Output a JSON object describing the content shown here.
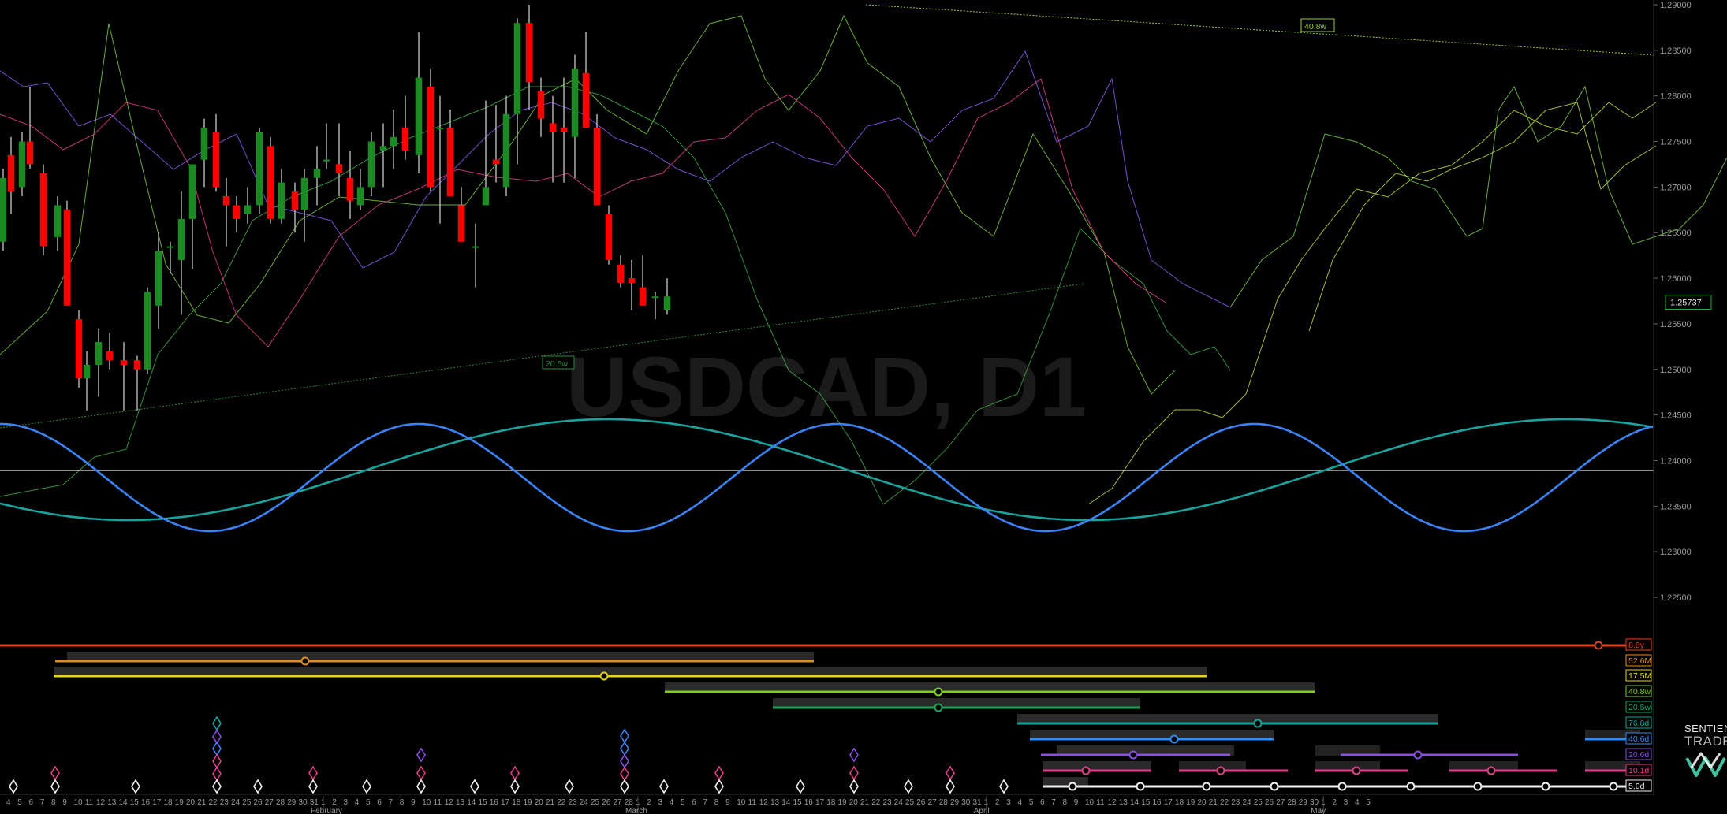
{
  "chart_data": {
    "type": "candlestick",
    "symbol": "USDCAD, D1",
    "yaxis": {
      "range": [
        1.2175,
        1.2905
      ],
      "ticks": [
        "1.29000",
        "1.28500",
        "1.28000",
        "1.27500",
        "1.27000",
        "1.26500",
        "1.26000",
        "1.25500",
        "1.25000",
        "1.24500",
        "1.24000",
        "1.23500",
        "1.23000",
        "1.22500"
      ]
    },
    "current_price": "1.25737",
    "candles": [
      {
        "o": 1.264,
        "h": 1.272,
        "l": 1.263,
        "c": 1.271
      },
      {
        "o": 1.2735,
        "h": 1.2755,
        "l": 1.267,
        "c": 1.2695
      },
      {
        "o": 1.27,
        "h": 1.276,
        "l": 1.269,
        "c": 1.275
      },
      {
        "o": 1.275,
        "h": 1.281,
        "l": 1.272,
        "c": 1.2725
      },
      {
        "o": 1.2715,
        "h": 1.2725,
        "l": 1.2625,
        "c": 1.2635
      },
      {
        "o": 1.2645,
        "h": 1.269,
        "l": 1.263,
        "c": 1.268
      },
      {
        "o": 1.2675,
        "h": 1.2685,
        "l": 1.257,
        "c": 1.257
      },
      {
        "o": 1.2555,
        "h": 1.2565,
        "l": 1.248,
        "c": 1.249
      },
      {
        "o": 1.249,
        "h": 1.252,
        "l": 1.2455,
        "c": 1.2505
      },
      {
        "o": 1.2505,
        "h": 1.2545,
        "l": 1.247,
        "c": 1.253
      },
      {
        "o": 1.252,
        "h": 1.254,
        "l": 1.25,
        "c": 1.251
      },
      {
        "o": 1.251,
        "h": 1.253,
        "l": 1.2455,
        "c": 1.2505
      },
      {
        "o": 1.251,
        "h": 1.2515,
        "l": 1.2455,
        "c": 1.25
      },
      {
        "o": 1.25,
        "h": 1.259,
        "l": 1.2495,
        "c": 1.2585
      },
      {
        "o": 1.257,
        "h": 1.265,
        "l": 1.2545,
        "c": 1.263
      },
      {
        "o": 1.2635,
        "h": 1.264,
        "l": 1.2605,
        "c": 1.2635
      },
      {
        "o": 1.262,
        "h": 1.2695,
        "l": 1.256,
        "c": 1.2665
      },
      {
        "o": 1.2665,
        "h": 1.2725,
        "l": 1.261,
        "c": 1.2725
      },
      {
        "o": 1.273,
        "h": 1.2775,
        "l": 1.27,
        "c": 1.2765
      },
      {
        "o": 1.276,
        "h": 1.278,
        "l": 1.2695,
        "c": 1.27
      },
      {
        "o": 1.269,
        "h": 1.271,
        "l": 1.2635,
        "c": 1.268
      },
      {
        "o": 1.268,
        "h": 1.269,
        "l": 1.265,
        "c": 1.2665
      },
      {
        "o": 1.267,
        "h": 1.27,
        "l": 1.266,
        "c": 1.268
      },
      {
        "o": 1.268,
        "h": 1.2765,
        "l": 1.267,
        "c": 1.276
      },
      {
        "o": 1.2745,
        "h": 1.2755,
        "l": 1.266,
        "c": 1.2665
      },
      {
        "o": 1.2665,
        "h": 1.272,
        "l": 1.266,
        "c": 1.2705
      },
      {
        "o": 1.2695,
        "h": 1.2705,
        "l": 1.265,
        "c": 1.2675
      },
      {
        "o": 1.2675,
        "h": 1.272,
        "l": 1.264,
        "c": 1.271
      },
      {
        "o": 1.271,
        "h": 1.2745,
        "l": 1.268,
        "c": 1.272
      },
      {
        "o": 1.273,
        "h": 1.277,
        "l": 1.272,
        "c": 1.273
      },
      {
        "o": 1.2725,
        "h": 1.277,
        "l": 1.269,
        "c": 1.2715
      },
      {
        "o": 1.271,
        "h": 1.274,
        "l": 1.2665,
        "c": 1.2685
      },
      {
        "o": 1.268,
        "h": 1.272,
        "l": 1.2675,
        "c": 1.27
      },
      {
        "o": 1.27,
        "h": 1.276,
        "l": 1.269,
        "c": 1.275
      },
      {
        "o": 1.274,
        "h": 1.277,
        "l": 1.27,
        "c": 1.2745
      },
      {
        "o": 1.2745,
        "h": 1.2785,
        "l": 1.272,
        "c": 1.2755
      },
      {
        "o": 1.2765,
        "h": 1.28,
        "l": 1.273,
        "c": 1.274
      },
      {
        "o": 1.2735,
        "h": 1.287,
        "l": 1.2715,
        "c": 1.282
      },
      {
        "o": 1.281,
        "h": 1.283,
        "l": 1.2695,
        "c": 1.27
      },
      {
        "o": 1.2765,
        "h": 1.28,
        "l": 1.266,
        "c": 1.2765
      },
      {
        "o": 1.2765,
        "h": 1.2785,
        "l": 1.269,
        "c": 1.269
      },
      {
        "o": 1.268,
        "h": 1.27,
        "l": 1.264,
        "c": 1.264
      },
      {
        "o": 1.2635,
        "h": 1.266,
        "l": 1.259,
        "c": 1.2635
      },
      {
        "o": 1.268,
        "h": 1.2795,
        "l": 1.268,
        "c": 1.27
      },
      {
        "o": 1.273,
        "h": 1.279,
        "l": 1.2705,
        "c": 1.2725
      },
      {
        "o": 1.27,
        "h": 1.28,
        "l": 1.269,
        "c": 1.278
      },
      {
        "o": 1.278,
        "h": 1.2885,
        "l": 1.2725,
        "c": 1.288
      },
      {
        "o": 1.288,
        "h": 1.29,
        "l": 1.2785,
        "c": 1.2815
      },
      {
        "o": 1.2805,
        "h": 1.282,
        "l": 1.2755,
        "c": 1.2775
      },
      {
        "o": 1.277,
        "h": 1.28,
        "l": 1.2705,
        "c": 1.276
      },
      {
        "o": 1.2765,
        "h": 1.282,
        "l": 1.2705,
        "c": 1.276
      },
      {
        "o": 1.2755,
        "h": 1.2845,
        "l": 1.271,
        "c": 1.283
      },
      {
        "o": 1.2825,
        "h": 1.287,
        "l": 1.2765,
        "c": 1.2765
      },
      {
        "o": 1.2765,
        "h": 1.278,
        "l": 1.268,
        "c": 1.268
      },
      {
        "o": 1.267,
        "h": 1.268,
        "l": 1.2615,
        "c": 1.262
      },
      {
        "o": 1.2615,
        "h": 1.2625,
        "l": 1.259,
        "c": 1.2595
      },
      {
        "o": 1.26,
        "h": 1.262,
        "l": 1.2565,
        "c": 1.2595
      },
      {
        "o": 1.259,
        "h": 1.2625,
        "l": 1.257,
        "c": 1.257
      },
      {
        "o": 1.258,
        "h": 1.2585,
        "l": 1.2555,
        "c": 1.258
      },
      {
        "o": 1.2565,
        "h": 1.26,
        "l": 1.256,
        "c": 1.258
      }
    ],
    "candle_x": [
      0,
      10,
      24,
      34,
      51,
      69,
      81,
      96,
      106,
      121,
      135,
      153,
      170,
      183,
      197,
      212,
      226,
      240,
      255,
      270,
      283,
      296,
      310,
      325,
      339,
      353,
      370,
      382,
      398,
      410,
      426,
      440,
      453,
      467,
      482,
      495,
      510,
      527,
      542,
      554,
      567,
      581,
      599,
      612,
      625,
      638,
      652,
      667,
      682,
      697,
      711,
      725,
      739,
      753,
      768,
      783,
      797,
      811,
      827,
      842
    ],
    "time_axis": {
      "dates": [
        "4",
        "5",
        "6",
        "7",
        "8",
        "9",
        "10",
        "11",
        "12",
        "13",
        "14",
        "15",
        "16",
        "17",
        "18",
        "19",
        "20",
        "21",
        "22",
        "23",
        "24",
        "25",
        "26",
        "27",
        "28",
        "29",
        "30",
        "31",
        "1",
        "2",
        "3",
        "4",
        "5",
        "6",
        "7",
        "8",
        "9",
        "10",
        "11",
        "12",
        "13",
        "14",
        "15",
        "16",
        "17",
        "18",
        "19",
        "20",
        "21",
        "22",
        "23",
        "24",
        "25",
        "26",
        "27",
        "28",
        "1",
        "2",
        "3",
        "4",
        "5",
        "6",
        "7",
        "8",
        "9",
        "10",
        "11",
        "12",
        "13",
        "14",
        "15",
        "16",
        "17",
        "18",
        "19",
        "20",
        "21",
        "22",
        "23",
        "24",
        "25",
        "26",
        "27",
        "28",
        "29",
        "30",
        "31",
        "1",
        "2",
        "3",
        "4",
        "5",
        "6",
        "7",
        "8",
        "9",
        "10",
        "11",
        "12",
        "13",
        "14",
        "15",
        "16",
        "17",
        "18",
        "19",
        "20",
        "21",
        "22",
        "23",
        "24",
        "25",
        "26",
        "27",
        "28",
        "29",
        "30",
        "1",
        "2",
        "3",
        "4",
        "5"
      ],
      "months": [
        {
          "label": "February",
          "after_index": 28
        },
        {
          "label": "March",
          "after_index": 56
        },
        {
          "label": "April",
          "after_index": 87
        },
        {
          "label": "May",
          "after_index": 117
        }
      ]
    },
    "trendlines": [
      {
        "name": "20.5w",
        "color": "#2e8b3a",
        "label_box": true
      },
      {
        "name": "40.8w",
        "color": "#9acd32",
        "label_box": true
      }
    ],
    "watermark": "USDCAD, D1",
    "cycles": [
      {
        "label": "8.8y",
        "color": "#e2421b"
      },
      {
        "label": "52.6M",
        "color": "#e38b19"
      },
      {
        "label": "17.5M",
        "color": "#e7d21a"
      },
      {
        "label": "40.8w",
        "color": "#7fcf1e"
      },
      {
        "label": "20.5w",
        "color": "#19a35a"
      },
      {
        "label": "76.8d",
        "color": "#17a39e"
      },
      {
        "label": "40.6d",
        "color": "#2e8ef5"
      },
      {
        "label": "20.6d",
        "color": "#8a4fe0"
      },
      {
        "label": "10.1d",
        "color": "#e0408a"
      },
      {
        "label": "5.0d",
        "color": "#f0f0f0"
      }
    ],
    "colors": {
      "bull": "#1c8a23",
      "bear": "#ff0000",
      "wick": "#bbbbbb",
      "wave_blue": "#3b82f6",
      "wave_teal": "#1aa39c",
      "hline": "#d9d9d9",
      "axis_text": "#9a9a9a"
    }
  },
  "brand": {
    "line1": "SENTIENT",
    "line2": "TRADER"
  }
}
